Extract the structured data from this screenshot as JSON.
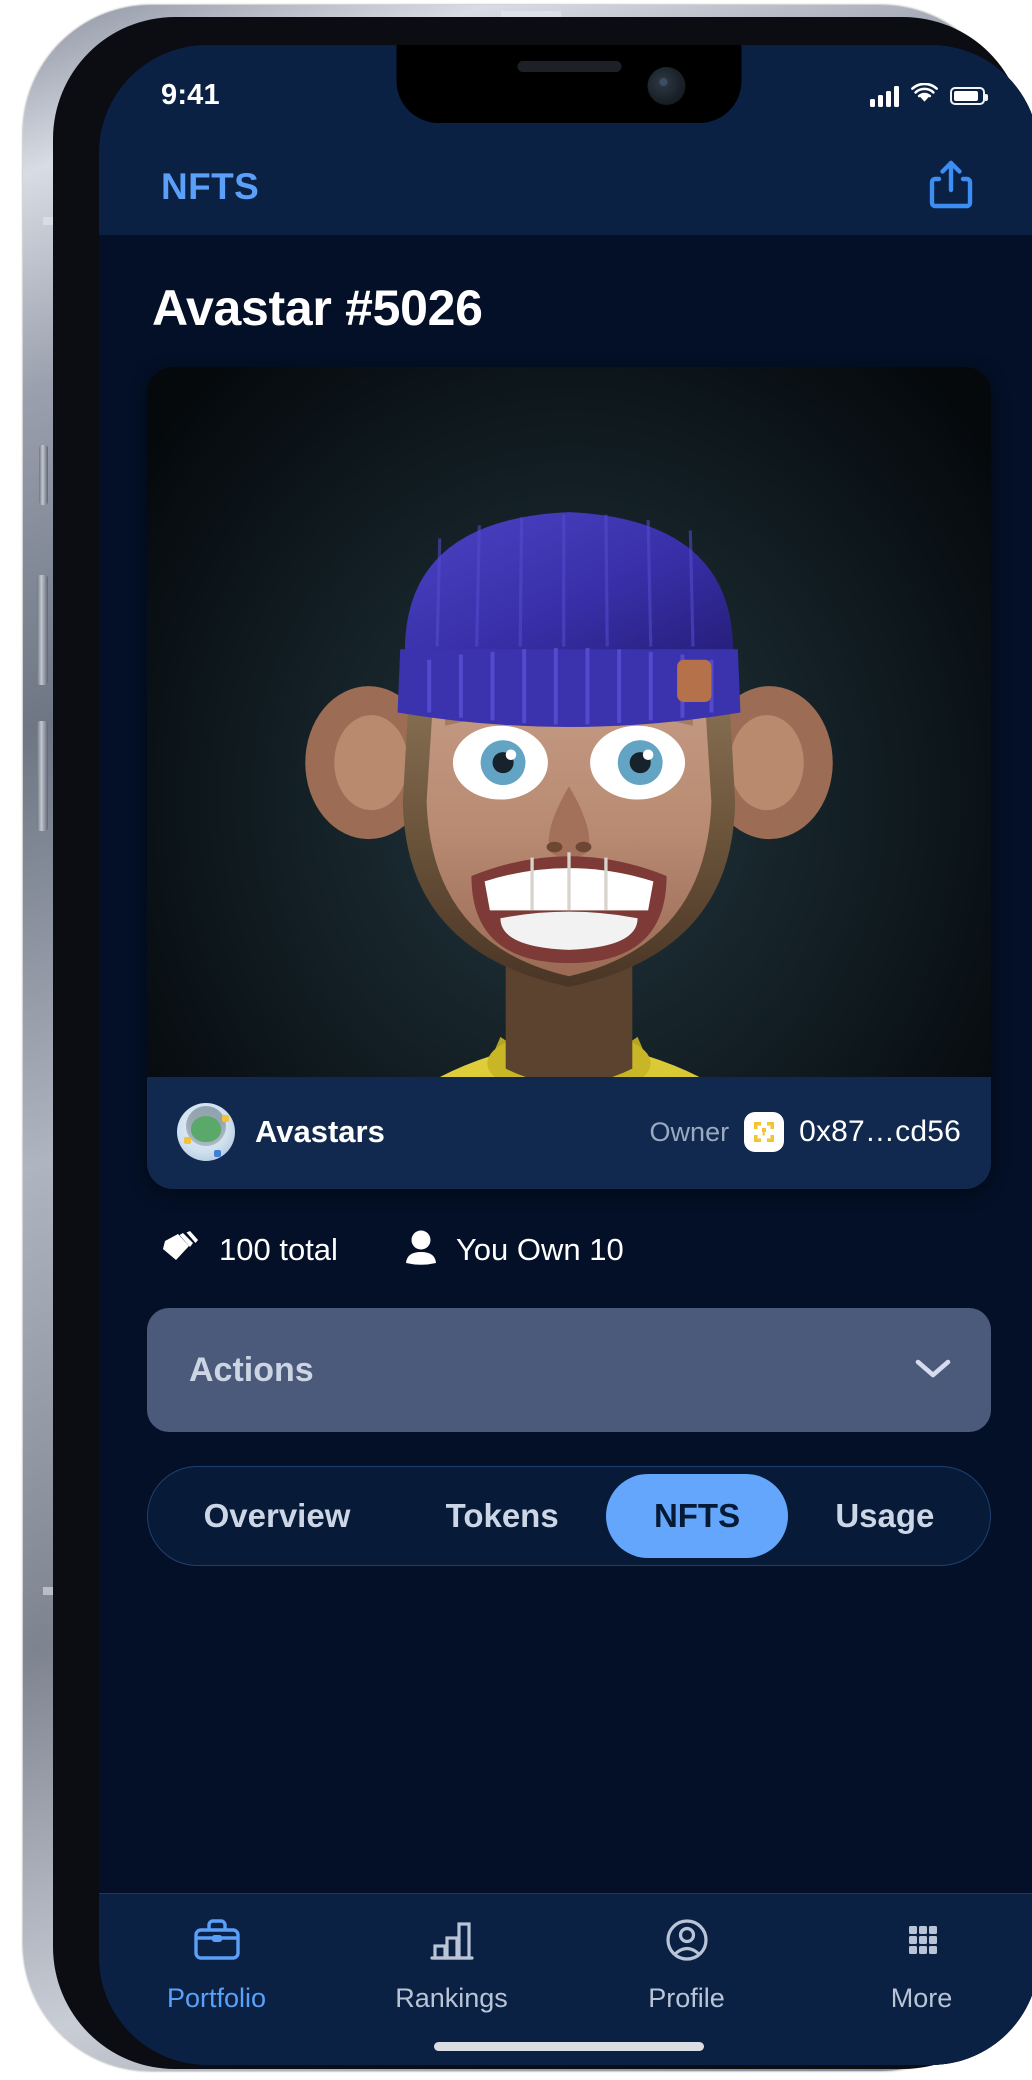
{
  "status_bar": {
    "time": "9:41",
    "icons": [
      "cellular-signal-icon",
      "wifi-icon",
      "battery-icon"
    ]
  },
  "header": {
    "title": "NFTS",
    "title_color": "#5aa0f8",
    "share_icon": "share-icon"
  },
  "detail": {
    "page_title": "Avastar #5026",
    "collection": {
      "name": "Avastars",
      "avatar_icon": "avastars-collection-avatar"
    },
    "owner": {
      "label": "Owner",
      "wallet_icon": "metamask-wallet-icon",
      "address": "0x87…cd56"
    },
    "stats": [
      {
        "icon": "tag-stack-icon",
        "text": "100 total"
      },
      {
        "icon": "person-icon",
        "text": "You Own 10"
      }
    ],
    "actions": {
      "label": "Actions",
      "chevron_icon": "chevron-down-icon",
      "background": "#4b597a"
    }
  },
  "tabs": {
    "items": [
      {
        "label": "Overview",
        "active": false
      },
      {
        "label": "Tokens",
        "active": false
      },
      {
        "label": "NFTS",
        "active": true
      },
      {
        "label": "Usage",
        "active": false
      }
    ],
    "active_background": "#63a6fb"
  },
  "bottom_nav": {
    "items": [
      {
        "label": "Portfolio",
        "icon": "briefcase-icon",
        "active": true
      },
      {
        "label": "Rankings",
        "icon": "bar-chart-icon",
        "active": false
      },
      {
        "label": "Profile",
        "icon": "user-circle-icon",
        "active": false
      },
      {
        "label": "More",
        "icon": "grid-dots-icon",
        "active": false
      }
    ],
    "active_color": "#5aa0f8",
    "inactive_color": "#b9c4d6"
  },
  "theme": {
    "app_background": "#041027",
    "bar_background": "#0b2144",
    "card_background": "#11294e",
    "accent": "#5aa0f8"
  }
}
